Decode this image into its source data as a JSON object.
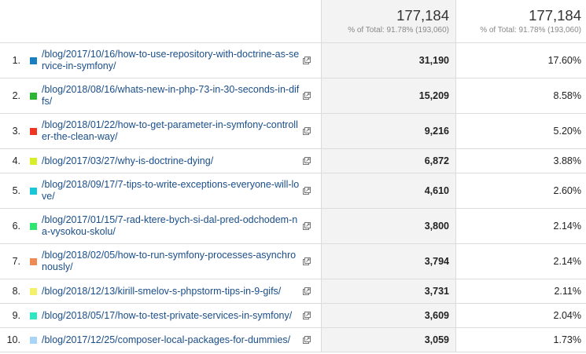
{
  "header": {
    "sessions_total": "177,184",
    "sessions_pct": "% of Total: 91.78% (193,060)",
    "share_total": "177,184",
    "share_pct": "% of Total: 91.78% (193,060)"
  },
  "rows": [
    {
      "rank": "1.",
      "page": "/blog/2017/10/16/how-to-use-repository-with-doctrine-as-service-in-symfony/",
      "value": "31,190",
      "percent": "17.60%",
      "color": "#1a7fc1"
    },
    {
      "rank": "2.",
      "page": "/blog/2018/08/16/whats-new-in-php-73-in-30-seconds-in-diffs/",
      "value": "15,209",
      "percent": "8.58%",
      "color": "#2ab534"
    },
    {
      "rank": "3.",
      "page": "/blog/2018/01/22/how-to-get-parameter-in-symfony-controller-the-clean-way/",
      "value": "9,216",
      "percent": "5.20%",
      "color": "#ee3524"
    },
    {
      "rank": "4.",
      "page": "/blog/2017/03/27/why-is-doctrine-dying/",
      "value": "6,872",
      "percent": "3.88%",
      "color": "#d8ee2a"
    },
    {
      "rank": "5.",
      "page": "/blog/2018/09/17/7-tips-to-write-exceptions-everyone-will-love/",
      "value": "4,610",
      "percent": "2.60%",
      "color": "#17c6d9"
    },
    {
      "rank": "6.",
      "page": "/blog/2017/01/15/7-rad-ktere-bych-si-dal-pred-odchodem-na-vysokou-skolu/",
      "value": "3,800",
      "percent": "2.14%",
      "color": "#2ee572"
    },
    {
      "rank": "7.",
      "page": "/blog/2018/02/05/how-to-run-symfony-processes-asynchronously/",
      "value": "3,794",
      "percent": "2.14%",
      "color": "#ef8a55"
    },
    {
      "rank": "8.",
      "page": "/blog/2018/12/13/kirill-smelov-s-phpstorm-tips-in-9-gifs/",
      "value": "3,731",
      "percent": "2.11%",
      "color": "#f3f06a"
    },
    {
      "rank": "9.",
      "page": "/blog/2018/05/17/how-to-test-private-services-in-symfony/",
      "value": "3,609",
      "percent": "2.04%",
      "color": "#2ee6c0"
    },
    {
      "rank": "10.",
      "page": "/blog/2017/12/25/composer-local-packages-for-dummies/",
      "value": "3,059",
      "percent": "1.73%",
      "color": "#a9d4f5"
    }
  ]
}
